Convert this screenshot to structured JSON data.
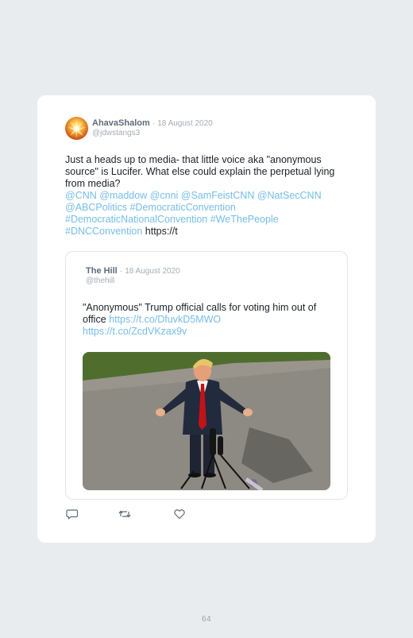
{
  "tweet": {
    "author_name": "AhavaShalom",
    "separator": "·",
    "date": "18 August 2020",
    "handle": "@jdwstangs3",
    "text_intro": "Just a heads up to media- that little voice aka \"anonymous source\" is Lucifer. What else could explain the perpetual lying from media?",
    "mentions": [
      "@CNN",
      "@maddow",
      "@cnni",
      "@SamFeistCNN",
      "@NatSecCNN",
      "@ABCPolitics"
    ],
    "hashtags": [
      "#DemocraticConvention",
      "#DemocraticNationalConvention",
      "#WeThePeople",
      "#DNCConvention"
    ],
    "trailing_text": "https://t"
  },
  "quoted": {
    "author_name": "The Hill",
    "separator": "·",
    "date": "18 August 2020",
    "handle": "@thehill",
    "text": "\"Anonymous\" Trump official calls for voting him out of office",
    "links": [
      "https://t.co/DfuvkD5MWO",
      "https://t.co/ZcdVKzax9v"
    ]
  },
  "actions": {
    "reply_icon": "reply-icon",
    "retweet_icon": "retweet-icon",
    "like_icon": "heart-icon"
  },
  "footer": {
    "page_number": "64"
  },
  "colors": {
    "background": "#e9ecef",
    "card": "#ffffff",
    "link": "#75bde8",
    "name": "#5e6b7a",
    "muted": "#a4acb6",
    "text": "#1c2128"
  }
}
